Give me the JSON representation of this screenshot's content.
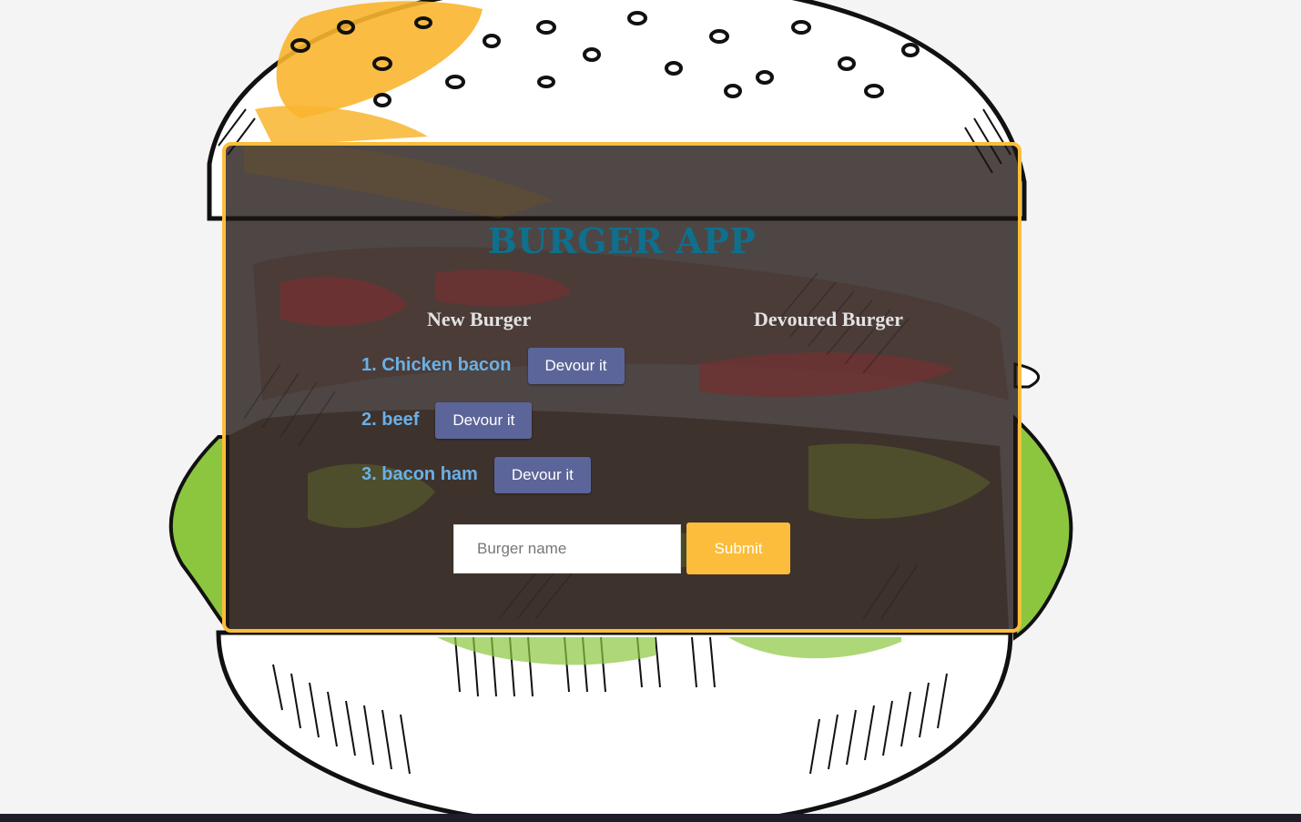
{
  "app": {
    "title": "BURGER APP"
  },
  "columns": {
    "new_heading": "New Burger",
    "devoured_heading": "Devoured Burger"
  },
  "burgers": [
    {
      "label": "1. Chicken bacon",
      "button": "Devour it"
    },
    {
      "label": "2. beef",
      "button": "Devour it"
    },
    {
      "label": "3. bacon ham",
      "button": "Devour it"
    }
  ],
  "form": {
    "placeholder": "Burger name",
    "value": "",
    "submit_label": "Submit"
  },
  "colors": {
    "accent": "#fbbd3b",
    "title": "#0f6f8c",
    "button": "#5c6599",
    "item_text": "#6ab0e6"
  }
}
